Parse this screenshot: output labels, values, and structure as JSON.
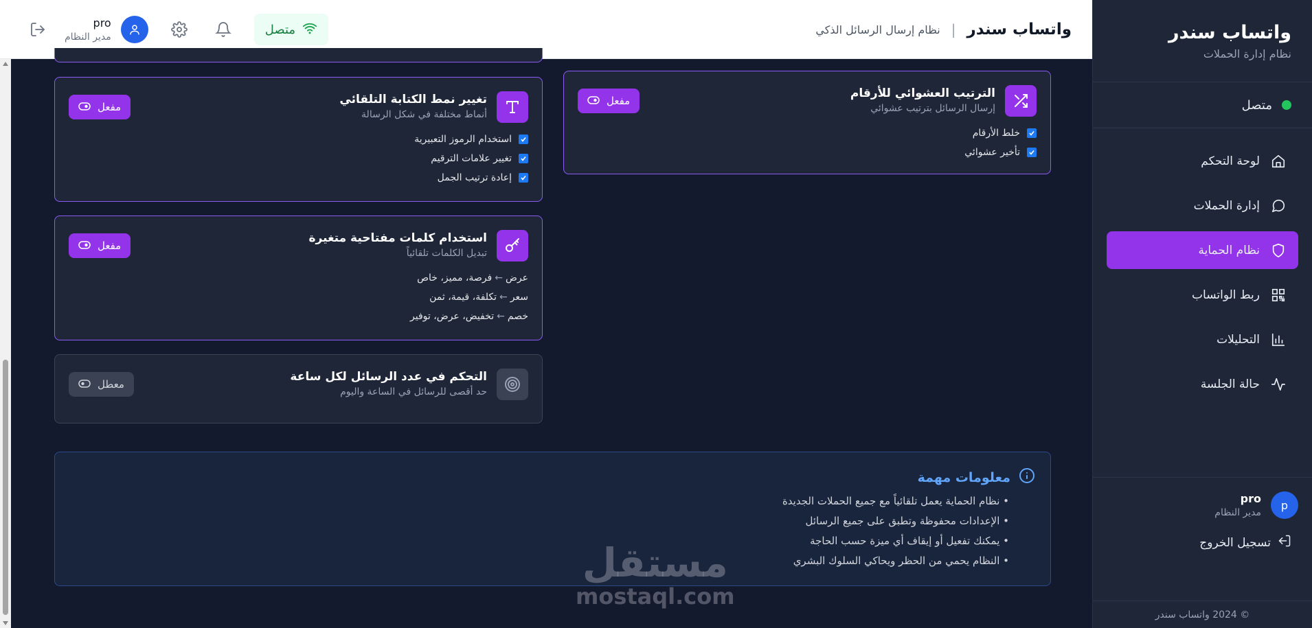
{
  "sidebar": {
    "brand_title": "واتساب سندر",
    "brand_subtitle": "نظام إدارة الحملات",
    "connection_label": "متصل",
    "items": [
      {
        "label": "لوحة التحكم",
        "icon": "home-icon"
      },
      {
        "label": "إدارة الحملات",
        "icon": "chat-icon"
      },
      {
        "label": "نظام الحماية",
        "icon": "shield-icon",
        "active": true
      },
      {
        "label": "ربط الواتساب",
        "icon": "qr-icon"
      },
      {
        "label": "التحليلات",
        "icon": "bar-chart-icon"
      },
      {
        "label": "حالة الجلسة",
        "icon": "activity-icon"
      }
    ],
    "user_initial": "p",
    "user_name": "pro",
    "user_role": "مدير النظام",
    "logout_label": "تسجيل الخروج",
    "copyright": "© 2024 واتساب سندر"
  },
  "header": {
    "title": "واتساب سندر",
    "separator": "|",
    "subtitle": "نظام إرسال الرسائل الذكي",
    "status_label": "متصل",
    "user_name": "pro",
    "user_role": "مدير النظام"
  },
  "cards": {
    "random_order": {
      "title": "الترتيب العشوائي للأرقام",
      "desc": "إرسال الرسائل بترتيب عشوائي",
      "toggle": "مفعل",
      "options": [
        "خلط الأرقام",
        "تأخير عشوائي"
      ]
    },
    "writing_style": {
      "title": "تغيير نمط الكتابة التلقائي",
      "desc": "أنماط مختلفة في شكل الرسالة",
      "toggle": "مفعل",
      "options": [
        "استخدام الرموز التعبيرية",
        "تغيير علامات الترقيم",
        "إعادة ترتيب الجمل"
      ]
    },
    "keywords": {
      "title": "استخدام كلمات مفتاحية متغيرة",
      "desc": "تبديل الكلمات تلقائياً",
      "toggle": "مفعل",
      "arrow": "←",
      "rows": [
        {
          "key": "عرض",
          "values": "فرصة، مميز، خاص"
        },
        {
          "key": "سعر",
          "values": "تكلفة، قيمة، ثمن"
        },
        {
          "key": "خصم",
          "values": "تخفيض، عرض، توفير"
        }
      ]
    },
    "rate_limit": {
      "title": "التحكم في عدد الرسائل لكل ساعة",
      "desc": "حد أقصى للرسائل في الساعة واليوم",
      "toggle": "معطل"
    }
  },
  "info": {
    "title": "معلومات مهمة",
    "items": [
      "• نظام الحماية يعمل تلقائياً مع جميع الحملات الجديدة",
      "• الإعدادات محفوظة وتطبق على جميع الرسائل",
      "• يمكنك تفعيل أو إيقاف أي ميزة حسب الحاجة",
      "• النظام يحمي من الحظر ويحاكي السلوك البشري"
    ]
  },
  "watermark": {
    "arabic": "مستقل",
    "latin": "mostaql.com"
  },
  "colors": {
    "accent": "#9333ea",
    "success": "#22c55e",
    "info": "#60a5fa",
    "background": "#141a2e",
    "card": "#1e2637"
  }
}
